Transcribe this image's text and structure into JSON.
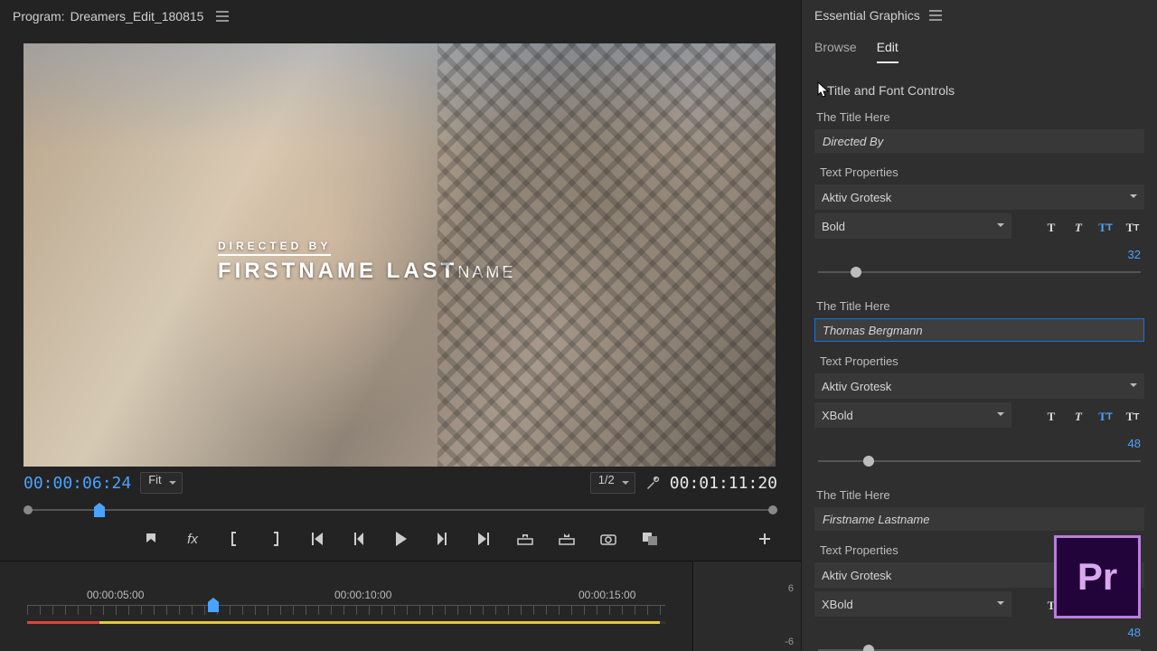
{
  "program": {
    "label_prefix": "Program:",
    "title": "Dreamers_Edit_180815",
    "overlay_line1": "DIRECTED BY",
    "overlay_line2a": "FIRSTNAME LAST",
    "overlay_line2b": "NAME",
    "tc_current": "00:00:06:24",
    "tc_total": "00:01:11:20",
    "zoom": "Fit",
    "res": "1/2"
  },
  "timeline": {
    "ticks": [
      "00:00:05:00",
      "00:00:10:00",
      "00:00:15:00"
    ],
    "side_top": "6",
    "side_bot": "-6"
  },
  "eg": {
    "title": "Essential Graphics",
    "tabs": {
      "browse": "Browse",
      "edit": "Edit"
    },
    "section": "Title and Font Controls",
    "blocks": [
      {
        "title_lbl": "The Title Here",
        "title_val": "Directed By",
        "tp_lbl": "Text Properties",
        "font": "Aktiv Grotesk",
        "weight": "Bold",
        "size": "32",
        "focused": false,
        "thumb": 10
      },
      {
        "title_lbl": "The Title Here",
        "title_val": "Thomas Bergmann",
        "tp_lbl": "Text Properties",
        "font": "Aktiv Grotesk",
        "weight": "XBold",
        "size": "48",
        "focused": true,
        "thumb": 14
      },
      {
        "title_lbl": "The Title Here",
        "title_val": "Firstname Lastname",
        "tp_lbl": "Text Properties",
        "font": "Aktiv Grotesk",
        "weight": "XBold",
        "size": "48",
        "focused": false,
        "thumb": 14
      }
    ]
  },
  "logo": "Pr"
}
